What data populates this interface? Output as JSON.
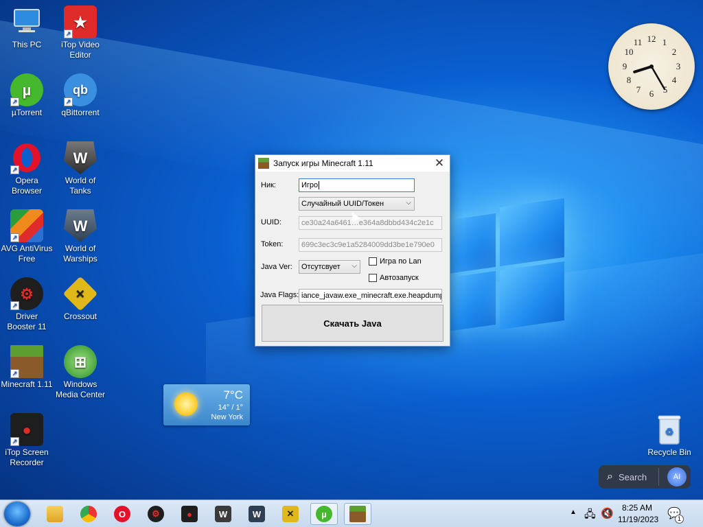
{
  "desktop_icons": [
    {
      "label": "This PC",
      "icon": "monitor-icon",
      "color": "#4aa3e6"
    },
    {
      "label": "iTop Video Editor",
      "icon": "itop-video-editor-icon",
      "color": "#e02b2b"
    },
    {
      "label": "µTorrent",
      "icon": "utorrent-icon",
      "color": "#46b82d"
    },
    {
      "label": "qBittorrent",
      "icon": "qbittorrent-icon",
      "color": "#3b8fe0"
    },
    {
      "label": "Opera Browser",
      "icon": "opera-icon",
      "color": "#e3122b"
    },
    {
      "label": "World of Tanks",
      "icon": "wot-icon",
      "color": "#3a3a3a"
    },
    {
      "label": "AVG AntiVirus Free",
      "icon": "avg-icon",
      "color": "#f08a1c"
    },
    {
      "label": "World of Warships",
      "icon": "wows-icon",
      "color": "#2e3f54"
    },
    {
      "label": "Driver Booster 11",
      "icon": "driver-booster-icon",
      "color": "#d0231d"
    },
    {
      "label": "Crossout",
      "icon": "crossout-icon",
      "color": "#e0b81a"
    },
    {
      "label": "Minecraft 1.11",
      "icon": "minecraft-icon",
      "color": "#5c8f2f"
    },
    {
      "label": "Windows Media Center",
      "icon": "windows-media-center-icon",
      "color": "#3a9d3a"
    },
    {
      "label": "iTop Screen Recorder",
      "icon": "itop-screen-recorder-icon",
      "color": "#1e1e1e"
    }
  ],
  "clock": {
    "hour": 8,
    "minute": 25
  },
  "weather": {
    "temp": "7°C",
    "range": "14° / 1°",
    "city": "New York"
  },
  "dialog": {
    "title": "Запуск игры Minecraft 1.11",
    "close": "✕",
    "nick_label": "Ник:",
    "nick_value": "Игро",
    "uuid_mode": "Случайный UUID/Токен",
    "uuid_label": "UUID:",
    "uuid_value": "ce30a24a6461…e364a8dbbd434c2e1c",
    "token_label": "Token:",
    "token_value": "699c3ec3c9e1a5284009dd3be1e790e0",
    "java_ver_label": "Java Ver:",
    "java_ver_value": "Отсутсвует",
    "lan_label": "Игра по Lan",
    "autostart_label": "Автозапуск",
    "java_flags_label": "Java Flags:",
    "java_flags_value": "iance_javaw.exe_minecraft.exe.heapdump",
    "download_button": "Скачать Java"
  },
  "recycle_bin": {
    "label": "Recycle Bin"
  },
  "search": {
    "placeholder": "Search",
    "ai_label": "AI"
  },
  "taskbar": {
    "items": [
      "file-explorer-icon",
      "chrome-icon",
      "opera-icon",
      "driver-booster-icon",
      "itop-screen-recorder-icon",
      "wot-icon",
      "wows-icon",
      "crossout-icon",
      "utorrent-icon",
      "minecraft-icon"
    ],
    "time": "8:25 AM",
    "date": "11/19/2023",
    "notification_count": "1"
  }
}
